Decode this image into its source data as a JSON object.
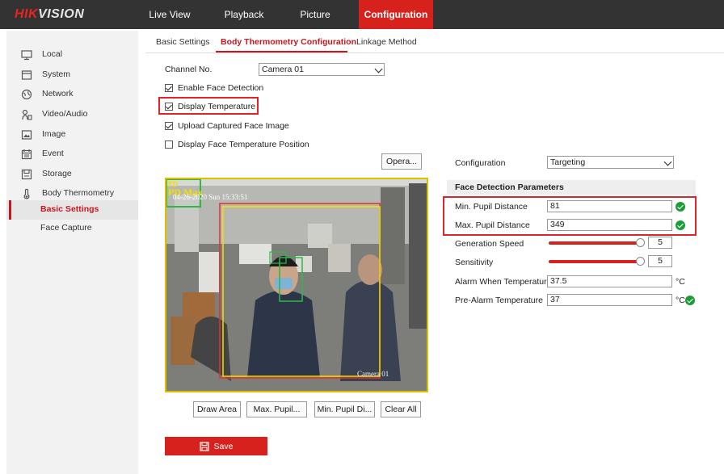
{
  "brand": {
    "logo_prefix": "HIK",
    "logo_suffix": "VISION"
  },
  "nav": [
    "Live View",
    "Playback",
    "Picture",
    "Configuration"
  ],
  "sidebar": {
    "items": [
      "Local",
      "System",
      "Network",
      "Video/Audio",
      "Image",
      "Event",
      "Storage",
      "Body Thermometry"
    ],
    "sub_items": [
      "Basic Settings",
      "Face Capture"
    ]
  },
  "tabs": [
    "Basic Settings",
    "Body Thermometry Configuration",
    "Linkage Method"
  ],
  "form": {
    "channel_label": "Channel No.",
    "channel_value": "Camera 01",
    "enable_face_detection": "Enable Face Detection",
    "display_temperature": "Display Temperature",
    "upload_face_image": "Upload Captured Face Image",
    "display_face_temp_position": "Display Face Temperature Position",
    "opera_button": "Opera..."
  },
  "video": {
    "timestamp": "04-26-2020 Sun 15:33:51",
    "corner_label": "PD",
    "max_label": "PD Max",
    "camera_label": "Camera 01"
  },
  "draw_buttons": [
    "Draw Area",
    "Max. Pupil...",
    "Min. Pupil Di...",
    "Clear All"
  ],
  "config": {
    "configuration_label": "Configuration",
    "configuration_value": "Targeting",
    "section_title": "Face Detection Parameters",
    "min_pupil_label": "Min. Pupil Distance",
    "min_pupil_value": "81",
    "max_pupil_label": "Max. Pupil Distance",
    "max_pupil_value": "349",
    "generation_speed_label": "Generation Speed",
    "generation_speed_value": "5",
    "sensitivity_label": "Sensitivity",
    "sensitivity_value": "5",
    "alarm_temp_label": "Alarm When Temperatur...",
    "alarm_temp_value": "37.5",
    "prealarm_temp_label": "Pre-Alarm Temperature",
    "prealarm_temp_value": "37",
    "unit": "°C"
  },
  "save_label": "Save",
  "colors": {
    "accent": "#d6211d",
    "topbar": "#333333",
    "ok_green": "#1e9b3a",
    "highlight": "#e0242a"
  }
}
